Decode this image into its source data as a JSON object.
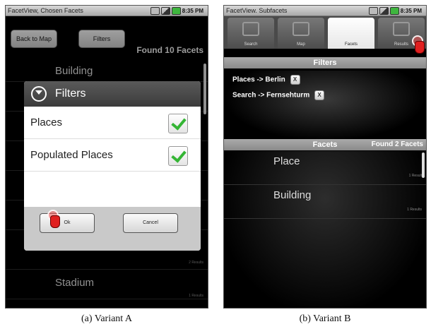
{
  "variant_a": {
    "status_title": "FacetView, Chosen Facets",
    "time": "8:35 PM",
    "back_button": "Back to Map",
    "filters_button": "Filters",
    "found_text": "Found 10 Facets",
    "list": [
      {
        "name": "Building",
        "count": ""
      },
      {
        "name": "",
        "count": "2 Results"
      },
      {
        "name": "Stadium",
        "count": "1 Results"
      }
    ],
    "dialog": {
      "title": "Filters",
      "options": [
        {
          "label": "Places",
          "checked": true
        },
        {
          "label": "Populated Places",
          "checked": true
        }
      ],
      "ok": "Ok",
      "cancel": "Cancel"
    },
    "caption": "(a) Variant A"
  },
  "variant_b": {
    "status_title": "FacetView. Subfacets",
    "time": "8:35 PM",
    "tabs": [
      {
        "label": "Search",
        "icon": "search-icon"
      },
      {
        "label": "Map",
        "icon": "map-icon"
      },
      {
        "label": "Facets",
        "icon": "facets-icon",
        "active": true
      },
      {
        "label": "Results",
        "icon": "results-icon"
      }
    ],
    "filters_header": "Filters",
    "filters": [
      {
        "text": "Places -> Berlin",
        "x": "X"
      },
      {
        "text": "Search -> Fernsehturm",
        "x": "X"
      }
    ],
    "facets_header": "Facets",
    "found_text": "Found 2 Facets",
    "facets": [
      {
        "name": "Place",
        "count": "1 Result"
      },
      {
        "name": "Building",
        "count": "1 Results"
      }
    ],
    "caption": "(b) Variant B"
  },
  "colors": {
    "check_green": "#34b534",
    "touch_red": "#e02020"
  }
}
